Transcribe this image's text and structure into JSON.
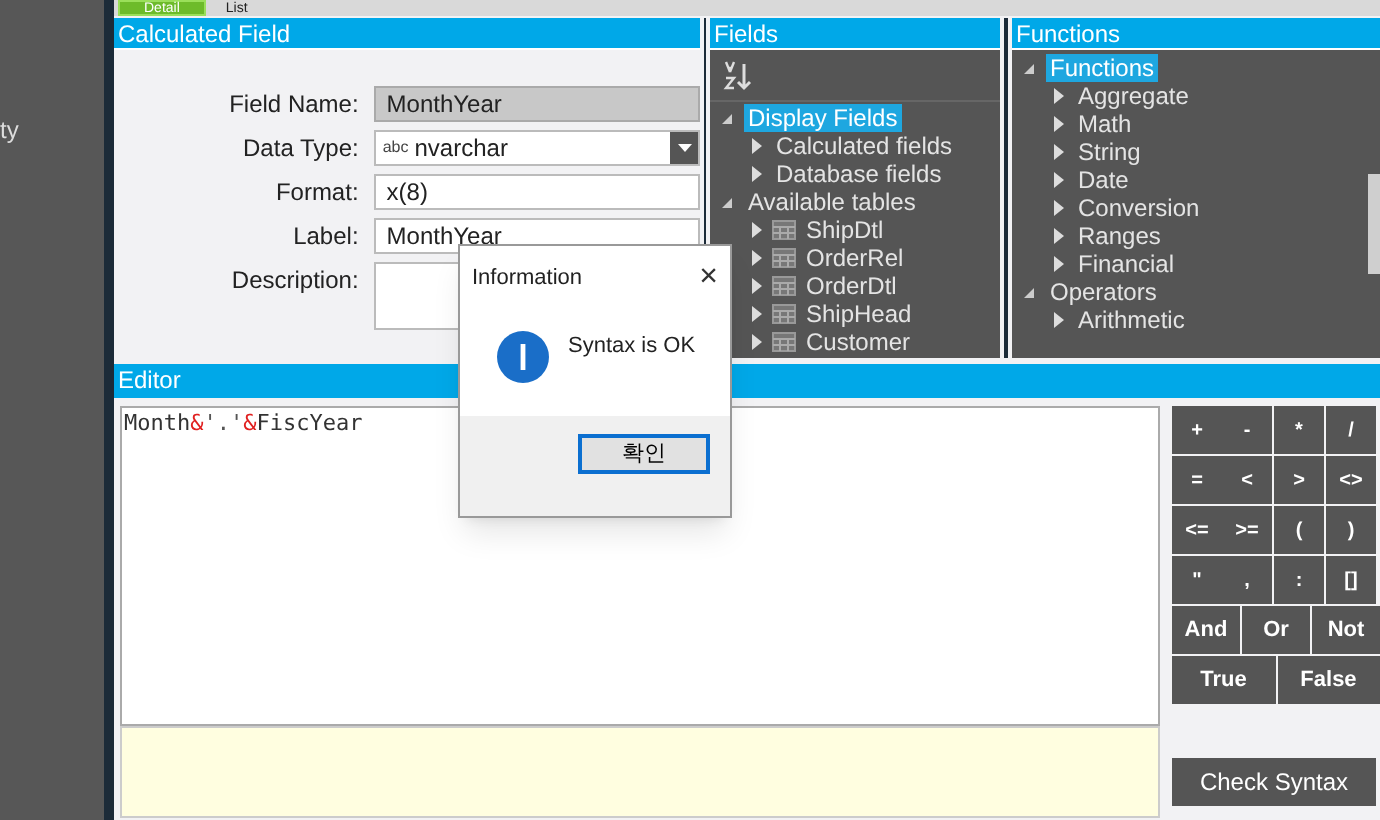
{
  "sidebar": {
    "items": [
      {
        "label": "ty"
      }
    ]
  },
  "view_tabs": [
    {
      "label": "Detail",
      "selected": true
    },
    {
      "label": "List",
      "selected": false
    }
  ],
  "calculated_field": {
    "title": "Calculated Field",
    "fields": [
      {
        "label": "Field Name:",
        "kind": "readonly",
        "value": "MonthYear"
      },
      {
        "label": "Data Type:",
        "kind": "dropdown",
        "value": "nvarchar",
        "prefix": "abc"
      },
      {
        "label": "Format:",
        "kind": "text",
        "value": "x(8)"
      },
      {
        "label": "Label:",
        "kind": "text",
        "value": "MonthYear"
      },
      {
        "label": "Description:",
        "kind": "textarea"
      }
    ]
  },
  "fields_panel": {
    "title": "Fields",
    "tree": [
      {
        "label": "Display Fields",
        "selected": true,
        "expanded": true,
        "children": [
          {
            "label": "Calculated fields",
            "expanded": false
          },
          {
            "label": "Database fields",
            "expanded": false
          }
        ]
      },
      {
        "label": "Available tables",
        "selected": false,
        "expanded": true,
        "children": [
          {
            "label": "ShipDtl",
            "expanded": false,
            "kind": "table"
          },
          {
            "label": "OrderRel",
            "expanded": false,
            "kind": "table"
          },
          {
            "label": "OrderDtl",
            "expanded": false,
            "kind": "table"
          },
          {
            "label": "ShipHead",
            "expanded": false,
            "kind": "table"
          },
          {
            "label": "Customer",
            "expanded": false,
            "kind": "table"
          }
        ]
      }
    ]
  },
  "functions_panel": {
    "title": "Functions",
    "tree": [
      {
        "label": "Functions",
        "selected": true,
        "expanded": true,
        "children": [
          {
            "label": "Aggregate",
            "expanded": false
          },
          {
            "label": "Math",
            "expanded": false
          },
          {
            "label": "String",
            "expanded": false
          },
          {
            "label": "Date",
            "expanded": false
          },
          {
            "label": "Conversion",
            "expanded": false
          },
          {
            "label": "Ranges",
            "expanded": false
          },
          {
            "label": "Financial",
            "expanded": false
          }
        ]
      },
      {
        "label": "Operators",
        "selected": false,
        "expanded": true,
        "children": [
          {
            "label": "Arithmetic",
            "expanded": false
          }
        ]
      }
    ]
  },
  "editor": {
    "title": "Editor",
    "tokens": [
      {
        "text": "Month",
        "kind": "identifier"
      },
      {
        "text": "&",
        "kind": "operator"
      },
      {
        "text": "'.'",
        "kind": "string"
      },
      {
        "text": "&",
        "kind": "operator"
      },
      {
        "text": "FiscYear",
        "kind": "identifier"
      }
    ]
  },
  "keypad": {
    "symbol_keys": [
      [
        "+",
        "-",
        "*",
        "/"
      ],
      [
        "=",
        "<",
        ">",
        "<>"
      ],
      [
        "<=",
        ">=",
        "(",
        ")"
      ],
      [
        "\"",
        ",",
        ":",
        "[]"
      ]
    ],
    "logical_keys": [
      "And",
      "Or",
      "Not"
    ],
    "constant_keys": [
      "True",
      "False"
    ],
    "check_button": "Check Syntax"
  },
  "dialog": {
    "title": "Information",
    "close": "×",
    "message": "Syntax is OK",
    "button": "확인"
  }
}
